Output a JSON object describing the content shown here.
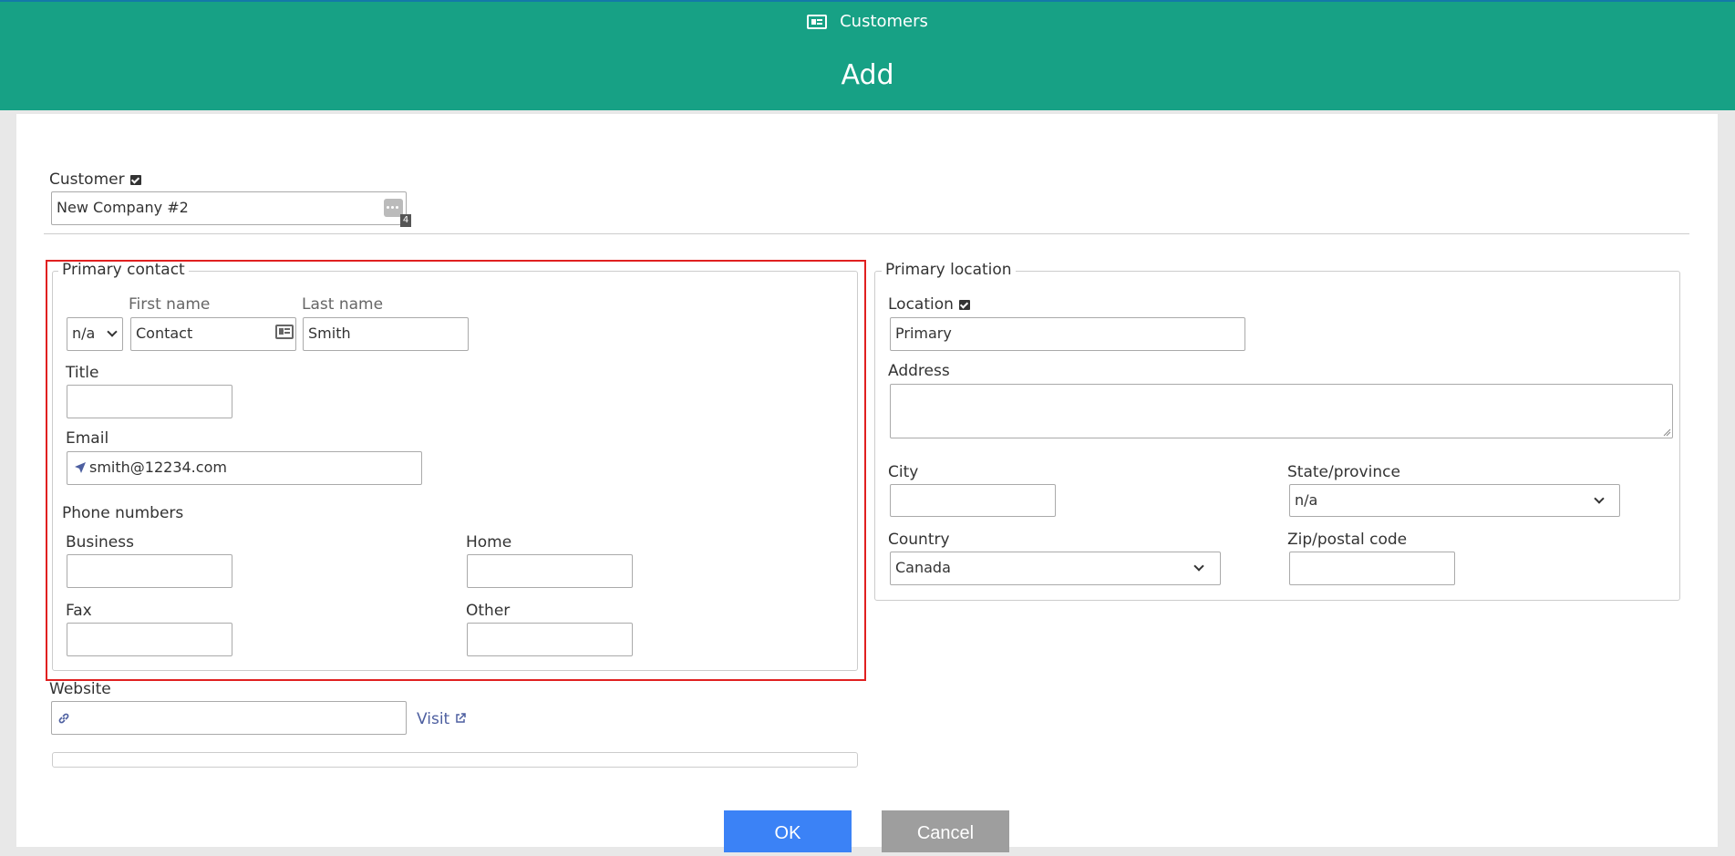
{
  "header": {
    "breadcrumb": "Customers",
    "title": "Add"
  },
  "customer": {
    "label": "Customer",
    "value": "New Company #2",
    "badge": "4"
  },
  "primary_contact": {
    "legend": "Primary contact",
    "salutation": "n/a",
    "first_name_label": "First name",
    "first_name_value": "Contact",
    "last_name_label": "Last name",
    "last_name_value": "Smith",
    "title_label": "Title",
    "title_value": "",
    "email_label": "Email",
    "email_value": "smith@12234.com",
    "phone_heading": "Phone numbers",
    "business_label": "Business",
    "home_label": "Home",
    "fax_label": "Fax",
    "other_label": "Other"
  },
  "website": {
    "label": "Website",
    "value": "",
    "visit_label": "Visit"
  },
  "primary_location": {
    "legend": "Primary location",
    "location_label": "Location",
    "location_value": "Primary",
    "address_label": "Address",
    "address_value": "",
    "city_label": "City",
    "city_value": "",
    "state_label": "State/province",
    "state_value": "n/a",
    "country_label": "Country",
    "country_value": "Canada",
    "zip_label": "Zip/postal code",
    "zip_value": ""
  },
  "buttons": {
    "ok": "OK",
    "cancel": "Cancel"
  },
  "colors": {
    "header": "#17a185",
    "ok": "#3b82f6",
    "cancel": "#9e9e9e",
    "highlight": "#e02020"
  }
}
